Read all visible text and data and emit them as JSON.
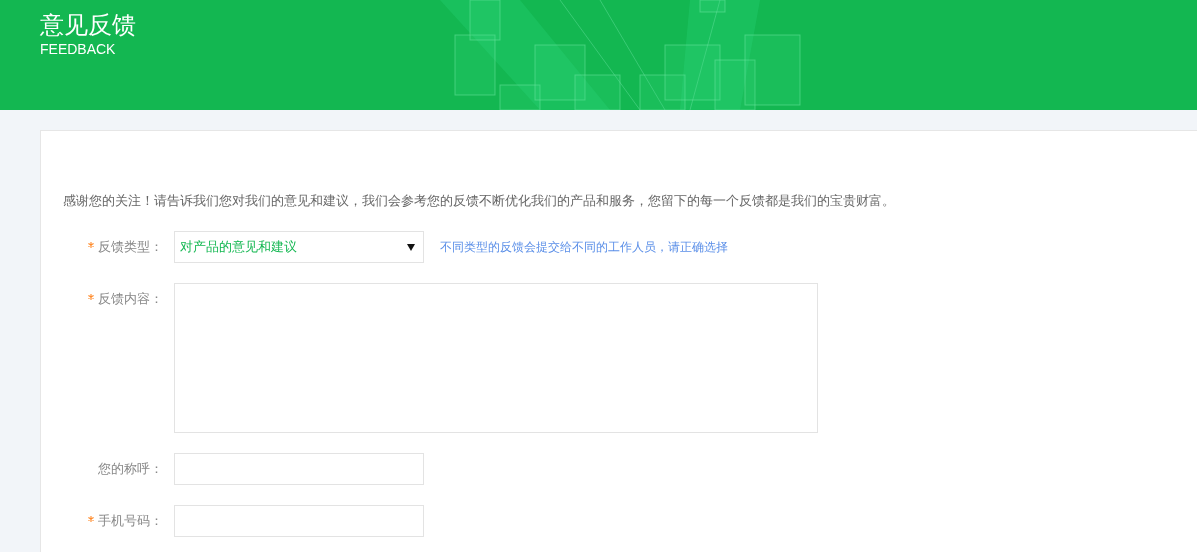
{
  "header": {
    "title": "意见反馈",
    "subtitle": "FEEDBACK"
  },
  "intro": "感谢您的关注！请告诉我们您对我们的意见和建议，我们会参考您的反馈不断优化我们的产品和服务，您留下的每一个反馈都是我们的宝贵财富。",
  "fields": [
    {
      "kind": "select",
      "label": "反馈类型：",
      "required": true,
      "value": "对产品的意见和建议",
      "hint": "不同类型的反馈会提交给不同的工作人员，请正确选择"
    },
    {
      "kind": "textarea",
      "label": "反馈内容：",
      "required": true
    },
    {
      "kind": "input",
      "label": "您的称呼：",
      "required": false
    },
    {
      "kind": "input",
      "label": "手机号码：",
      "required": true
    }
  ]
}
